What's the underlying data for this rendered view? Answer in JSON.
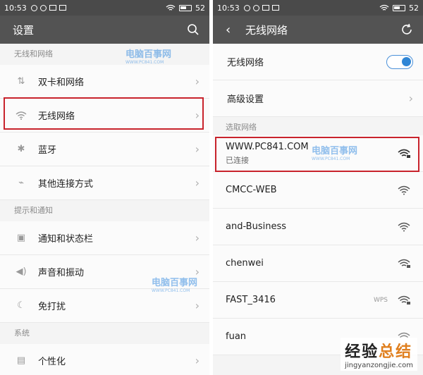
{
  "status": {
    "time": "10:53",
    "battery": "52"
  },
  "left": {
    "title": "设置",
    "sections": [
      {
        "header": "无线和网络",
        "items": [
          "双卡和网络",
          "无线网络",
          "蓝牙",
          "其他连接方式"
        ]
      },
      {
        "header": "提示和通知",
        "items": [
          "通知和状态栏",
          "声音和振动",
          "免打扰"
        ]
      },
      {
        "header": "系统",
        "items": [
          "个性化"
        ]
      }
    ]
  },
  "right": {
    "title": "无线网络",
    "wifi_label": "无线网络",
    "wifi_on": true,
    "advanced": "高级设置",
    "choose_header": "选取网络",
    "networks": [
      {
        "name": "WWW.PC841.COM",
        "status": "已连接",
        "wps": ""
      },
      {
        "name": "CMCC-WEB",
        "status": "",
        "wps": ""
      },
      {
        "name": "and-Business",
        "status": "",
        "wps": ""
      },
      {
        "name": "chenwei",
        "status": "",
        "wps": ""
      },
      {
        "name": "FAST_3416",
        "status": "",
        "wps": "WPS"
      },
      {
        "name": "fuan",
        "status": "",
        "wps": ""
      }
    ]
  },
  "watermark": {
    "text": "电脑百事网",
    "sub": "WWW.PC841.COM"
  },
  "brand": {
    "text_a": "经验",
    "text_b": "总结",
    "url": "jingyanzongjie.com"
  }
}
